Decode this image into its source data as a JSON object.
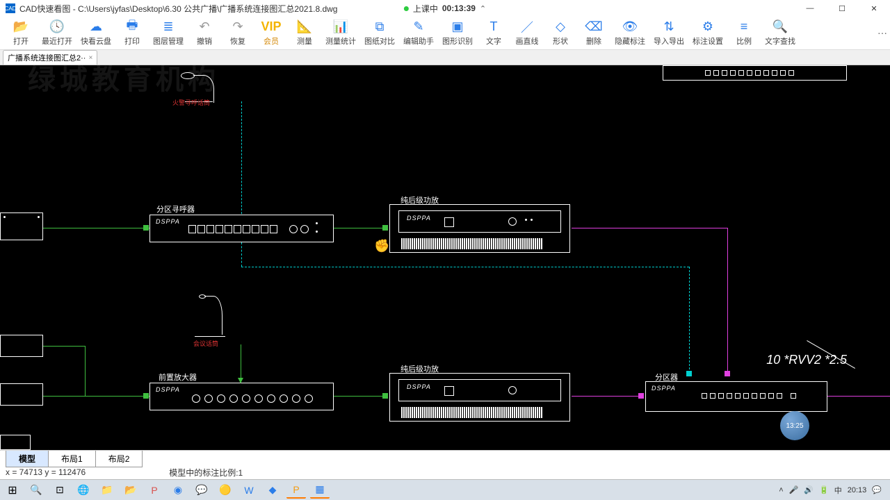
{
  "window": {
    "app_name": "CAD快速看图",
    "file_path": "C:\\Users\\jyfas\\Desktop\\6.30  公共广播\\广播系统连接图汇总2021.8.dwg",
    "status_label": "上课中",
    "status_timer": "00:13:39"
  },
  "toolbar": {
    "open": "打开",
    "recent": "最近打开",
    "cloud": "快看云盘",
    "print": "打印",
    "layer": "图层管理",
    "undo": "撤销",
    "redo": "恢复",
    "vip": "VIP",
    "member": "会员",
    "measure": "测量",
    "stats": "测量统计",
    "compare": "图纸对比",
    "edit": "编辑助手",
    "recognize": "图形识别",
    "text": "文字",
    "line": "画直线",
    "shape": "形状",
    "delete": "删除",
    "hide": "隐藏标注",
    "export": "导入导出",
    "annoset": "标注设置",
    "scale": "比例",
    "findtext": "文字查找"
  },
  "tab": {
    "name": "广播系统连接图汇总2··"
  },
  "labels": {
    "zone_pager": "分区寻呼器",
    "amp1": "纯后级功放",
    "amp2": "纯后级功放",
    "preamp": "前置放大器",
    "zoner": "分区器",
    "mic1": "火警寻呼话筒",
    "mic2": "会议话筒"
  },
  "cable": "10 *RVV2 *2.5",
  "brand": "DSPPA",
  "bubble_time": "13:25",
  "bottom_tabs": {
    "model": "模型",
    "layout1": "布局1",
    "layout2": "布局2"
  },
  "status_coords": "x = 74713  y = 112476",
  "status_scale": "模型中的标注比例:1",
  "tray": {
    "ime": "中",
    "time": "20:13"
  },
  "watermark": "绿城教育机构"
}
